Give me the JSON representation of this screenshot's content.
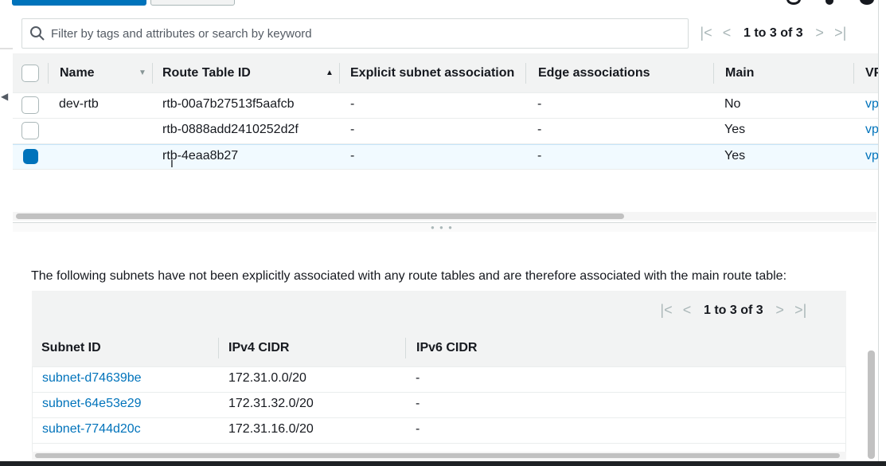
{
  "filter": {
    "placeholder": "Filter by tags and attributes or search by keyword"
  },
  "pager": {
    "first": "|<",
    "prev": "<",
    "text": "1 to 3 of 3",
    "next": ">",
    "last": ">|"
  },
  "route_tables": {
    "columns": [
      "Name",
      "Route Table ID",
      "Explicit subnet association",
      "Edge associations",
      "Main",
      "VP"
    ],
    "rows": [
      {
        "name": "dev-rtb",
        "id": "rtb-00a7b27513f5aafcb",
        "explicit": "-",
        "edge": "-",
        "main": "No",
        "vpc": "vp",
        "selected": false
      },
      {
        "name": "",
        "id": "rtb-0888add2410252d2f",
        "explicit": "-",
        "edge": "-",
        "main": "Yes",
        "vpc": "vp",
        "selected": false
      },
      {
        "name": "",
        "id": "rtb-4eaa8b27",
        "explicit": "-",
        "edge": "-",
        "main": "Yes",
        "vpc": "vp",
        "selected": true
      }
    ]
  },
  "details": {
    "note": "The following subnets have not been explicitly associated with any route tables and are therefore associated with the main route table:",
    "pager": {
      "text": "1 to 3 of 3"
    },
    "columns": [
      "Subnet ID",
      "IPv4 CIDR",
      "IPv6 CIDR"
    ],
    "rows": [
      {
        "subnet": "subnet-d74639be",
        "ipv4": "172.31.0.0/20",
        "ipv6": "-"
      },
      {
        "subnet": "subnet-64e53e29",
        "ipv4": "172.31.32.0/20",
        "ipv6": "-"
      },
      {
        "subnet": "subnet-7744d20c",
        "ipv4": "172.31.16.0/20",
        "ipv6": "-"
      }
    ]
  },
  "colors": {
    "accent": "#0073bb",
    "header_bg": "#f2f3f3",
    "selected_row": "#f1faff"
  }
}
